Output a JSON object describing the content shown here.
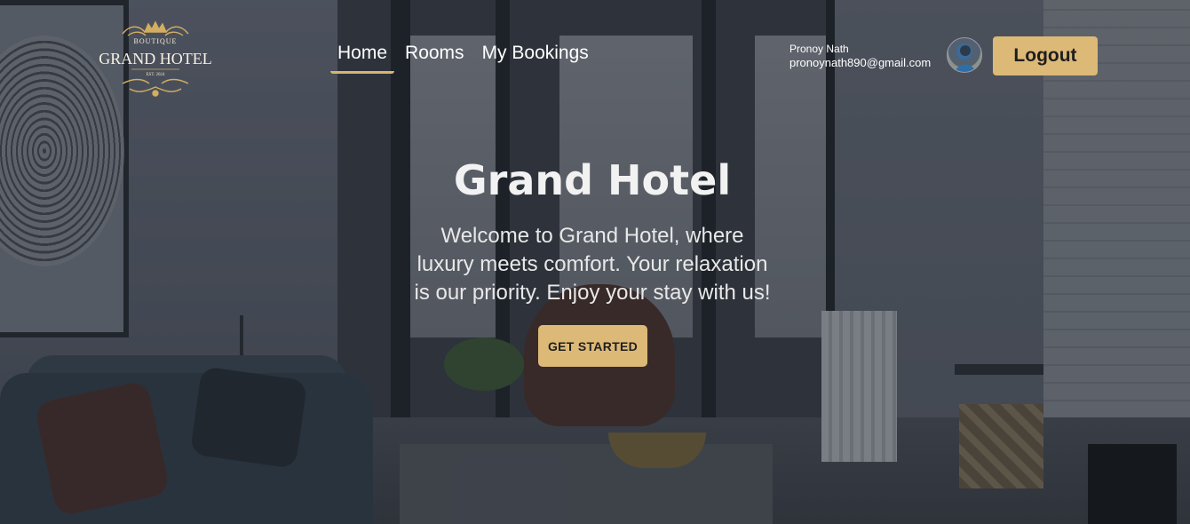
{
  "brand": {
    "logo_sub": "BOUTIQUE",
    "logo_main": "GRAND HOTEL",
    "logo_est": "EST. 2024",
    "accent_color": "#dcb977"
  },
  "nav": {
    "items": [
      {
        "label": "Home",
        "active": true
      },
      {
        "label": "Rooms",
        "active": false
      },
      {
        "label": "My Bookings",
        "active": false
      }
    ]
  },
  "user": {
    "name": "Pronoy Nath",
    "email": "pronoynath890@gmail.com",
    "avatar_icon": "user-avatar",
    "logout_label": "Logout"
  },
  "hero": {
    "title": "Grand Hotel",
    "line1": "Welcome to Grand Hotel, where",
    "line2": "luxury meets comfort. Your relaxation",
    "line3": "is our priority. Enjoy your stay with us!",
    "cta_label": "GET STARTED"
  }
}
